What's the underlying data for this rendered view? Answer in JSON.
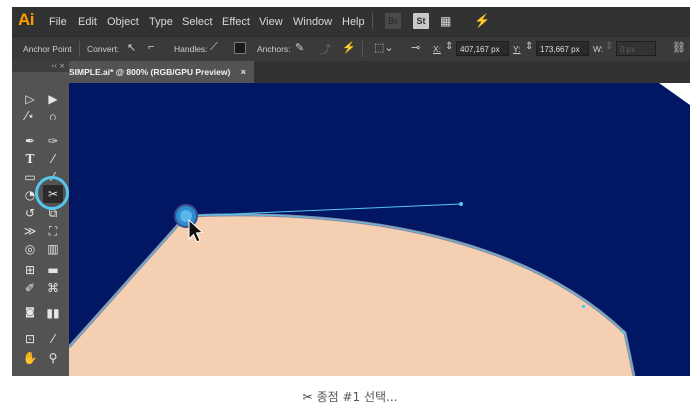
{
  "app": {
    "logo": "Ai",
    "menu": [
      "File",
      "Edit",
      "Object",
      "Type",
      "Select",
      "Effect",
      "View",
      "Window",
      "Help"
    ],
    "bridge_icon_label": "Br",
    "stock_icon_label": "St"
  },
  "control_bar": {
    "tool_name": "Anchor Point",
    "convert_label": "Convert:",
    "handles_label": "Handles:",
    "anchors_label": "Anchors:",
    "x_label": "X:",
    "x_value": "407,167 px",
    "y_label": "Y:",
    "y_value": "173,667 px",
    "w_label": "W:",
    "w_value": "0 px"
  },
  "document_tab": {
    "title": "SIMPLE.ai* @ 800% (RGB/GPU Preview)",
    "close": "×"
  },
  "tools_panel": {
    "collapse": "‹‹ ×",
    "active_tool": "scissors-tool"
  },
  "colors": {
    "canvas_bg": "#011763",
    "shape_fill": "#f5cfb2",
    "path_stroke": "#8d8aa0",
    "selection_blue": "#56c6ef",
    "app_bg": "#323232"
  },
  "caption": {
    "icon": "✂",
    "text": "종점 #1 선택..."
  }
}
